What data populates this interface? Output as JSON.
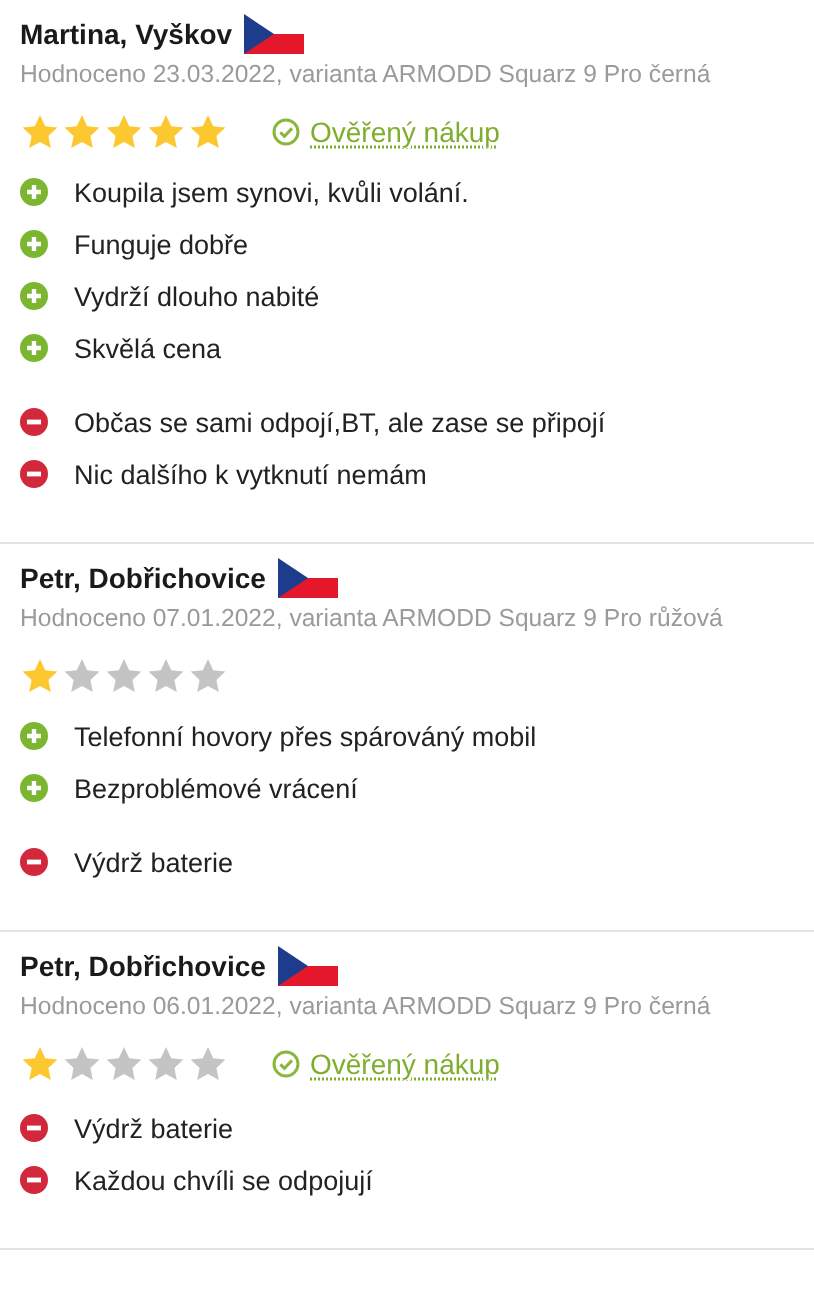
{
  "reviews": [
    {
      "author": "Martina, Vyškov",
      "meta": "Hodnoceno 23.03.2022, varianta ARMODD Squarz 9 Pro černá",
      "stars": 5,
      "verified": true,
      "verified_label": "Ověřený nákup",
      "pros": [
        "Koupila jsem synovi, kvůli volání.",
        "Funguje dobře",
        "Vydrží dlouho nabité",
        "Skvělá cena"
      ],
      "cons": [
        "Občas se sami odpojí,BT, ale zase se připojí",
        "Nic dalšího k vytknutí nemám"
      ]
    },
    {
      "author": "Petr, Dobřichovice",
      "meta": "Hodnoceno 07.01.2022, varianta ARMODD Squarz 9 Pro růžová",
      "stars": 1,
      "verified": false,
      "pros": [
        "Telefonní hovory přes spárováný mobil",
        "Bezproblémové vrácení"
      ],
      "cons": [
        "Výdrž baterie"
      ]
    },
    {
      "author": "Petr, Dobřichovice",
      "meta": "Hodnoceno 06.01.2022, varianta ARMODD Squarz 9 Pro černá",
      "stars": 1,
      "verified": true,
      "verified_label": "Ověřený nákup",
      "cons": [
        "Výdrž baterie",
        "Každou chvíli se odpojují"
      ]
    }
  ]
}
